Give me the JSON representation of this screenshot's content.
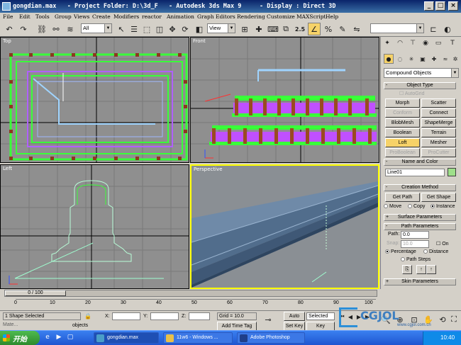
{
  "title_bar": {
    "text": "gongdian.max   - Project Folder: D:\\3d_F   - Autodesk 3ds Max 9     - Display : Direct 3D",
    "min": "_",
    "max": "□",
    "close": "×"
  },
  "menu": [
    "File",
    "Edit",
    "Tools",
    "Group",
    "Views",
    "Create",
    "Modifiers",
    "reactor",
    "Animation",
    "Graph Editors",
    "Rendering",
    "Customize",
    "MAXScript",
    "Help"
  ],
  "toolbar": {
    "selection_filter": "All",
    "ref_coord": "View",
    "snap_angle": "2.5",
    "named_selection": ""
  },
  "viewports": {
    "top": "Top",
    "front": "Front",
    "left": "Left",
    "perspective": "Perspective"
  },
  "command_panel": {
    "category": "Compound Objects",
    "object_type": {
      "header": "Object Type",
      "autogrid": "AutoGrid",
      "buttons": [
        "Morph",
        "Scatter",
        "Conform",
        "Connect",
        "BlobMesh",
        "ShapeMerge",
        "Boolean",
        "Terrain",
        "Loft",
        "Mesher",
        "ProBoolean",
        "ProCutter"
      ]
    },
    "name_color": {
      "header": "Name and Color",
      "name": "Line01",
      "color": "#9ee08a"
    },
    "creation_method": {
      "header": "Creation Method",
      "get_path": "Get Path",
      "get_shape": "Get Shape",
      "move": "Move",
      "copy": "Copy",
      "instance": "Instance"
    },
    "surface_params": "Surface Parameters",
    "path_params": {
      "header": "Path Parameters",
      "path_label": "Path:",
      "path_value": "0.0",
      "snap_label": "Snap:",
      "snap_value": "10.0",
      "on": "On",
      "percentage": "Percentage",
      "distance": "Distance",
      "path_steps": "Path Steps"
    },
    "skin_params": "Skin Parameters"
  },
  "timeline": {
    "frame_counter": "0 / 100",
    "ticks": [
      "0",
      "10",
      "20",
      "30",
      "40",
      "50",
      "60",
      "70",
      "80",
      "90",
      "100"
    ]
  },
  "status": {
    "selection": "1 Shape Selected",
    "prompt": "objects",
    "x_label": "X:",
    "y_label": "Y:",
    "z_label": "Z:",
    "grid": "Grid = 10.0",
    "add_time_tag": "Add Time Tag",
    "auto_key": "Auto Key",
    "set_key": "Set Key",
    "selected": "Selected",
    "key_filters": "Key Filters...",
    "maxscript": "Mate..."
  },
  "taskbar": {
    "start": "开始",
    "tasks": [
      "gongdian.max",
      "11w6 - Windows ...",
      "Adobe Photoshop"
    ],
    "clock": "10:40"
  },
  "watermark": {
    "text": "CGJOL",
    "sub": "www.cgjol.com.cn"
  },
  "colors": {
    "active_viewport": "#ffff00",
    "viewport_bg": "#8f8f8f",
    "loft_button": "#f6d268",
    "title_bar": "#0a246a"
  }
}
